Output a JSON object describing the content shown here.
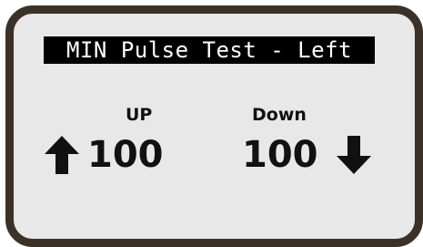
{
  "screen": {
    "title": "MIN Pulse Test - Left"
  },
  "up": {
    "label": "UP",
    "value": "100",
    "icon": "arrow-up-icon"
  },
  "down": {
    "label": "Down",
    "value": "100",
    "icon": "arrow-down-icon"
  },
  "colors": {
    "bezel": "#3a3129",
    "screen": "#e8e8e8",
    "title_bg": "#000000",
    "title_text": "#ffffff",
    "text": "#111111"
  }
}
